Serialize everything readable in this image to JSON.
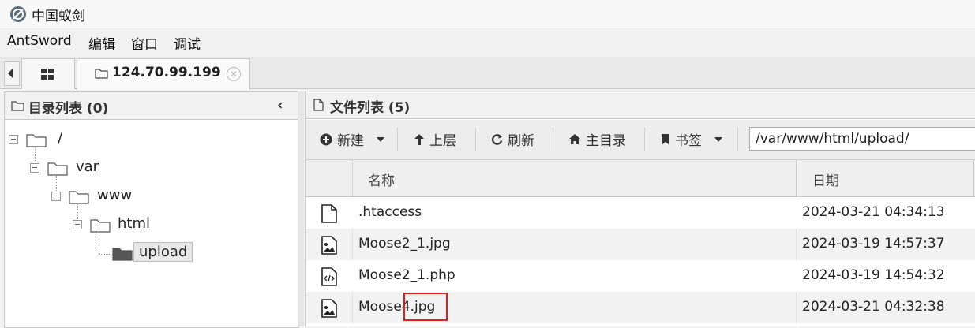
{
  "app": {
    "title": "中国蚁剑",
    "icon": "antsword-logo-icon"
  },
  "menu": [
    "AntSword",
    "编辑",
    "窗口",
    "调试"
  ],
  "tabs": {
    "home_icon": "grid-icon",
    "active": {
      "label": "124.70.99.199",
      "icon": "folder-icon",
      "close_icon": "close-icon"
    }
  },
  "left_panel": {
    "title": "目录列表 (0)",
    "tree": [
      {
        "label": "/",
        "depth": 0
      },
      {
        "label": "var",
        "depth": 1
      },
      {
        "label": "www",
        "depth": 2
      },
      {
        "label": "html",
        "depth": 3
      },
      {
        "label": "upload",
        "depth": 4,
        "selected": true
      }
    ]
  },
  "right_panel": {
    "title": "文件列表 (5)",
    "toolbar": {
      "new": "新建",
      "up": "上层",
      "refresh": "刷新",
      "home": "主目录",
      "bookmark": "书签",
      "path": "/var/www/html/upload/"
    },
    "columns": {
      "name": "名称",
      "date": "日期"
    },
    "files": [
      {
        "name": ".htaccess",
        "date": "2024-03-21 04:34:13",
        "icon": "file-icon"
      },
      {
        "name": "Moose2_1.jpg",
        "date": "2024-03-19 14:57:37",
        "icon": "image-file-icon"
      },
      {
        "name": "Moose2_1.php",
        "date": "2024-03-19 14:54:32",
        "icon": "code-file-icon"
      },
      {
        "name": "Moose4.jpg",
        "date": "2024-03-21 04:32:38",
        "icon": "image-file-icon"
      }
    ]
  },
  "colors": {
    "highlight": "#e02020",
    "folder_selected": "#555555"
  }
}
